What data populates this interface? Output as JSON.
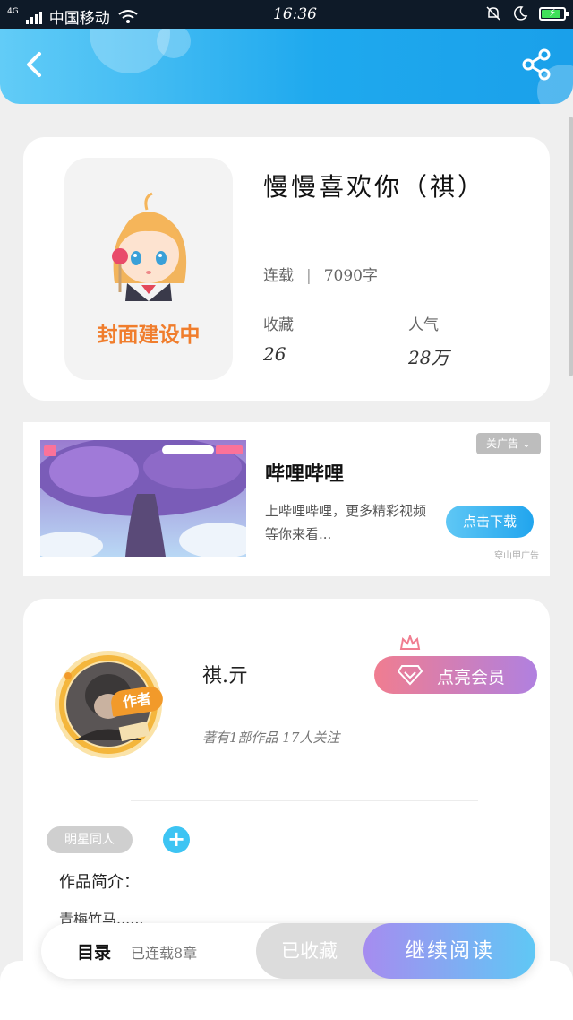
{
  "status_bar": {
    "network": "4G",
    "carrier": "中国移动",
    "time": "16:36"
  },
  "header": {
    "back_icon": "chevron-left-icon",
    "share_icon": "share-icon"
  },
  "book": {
    "cover_caption": "封面建设中",
    "title": "慢慢喜欢你（祺）",
    "status": "连载",
    "word_count": "7090字",
    "favorites_label": "收藏",
    "favorites_value": "26",
    "popularity_label": "人气",
    "popularity_value": "28万"
  },
  "ad": {
    "close_label": "关广告",
    "title": "哔哩哔哩",
    "description": "上哔哩哔哩，更多精彩视频等你来看...",
    "button_label": "点击下载",
    "source": "穿山甲广告"
  },
  "author": {
    "badge": "作者",
    "name": "祺.亓",
    "meta": "著有1部作品 17人关注",
    "vip_button": "点亮会员",
    "tag": "明星同人",
    "add_tag": "+",
    "intro_label": "作品简介：",
    "intro_text": "青梅竹马......"
  },
  "bottom_bar": {
    "toc_label": "目录",
    "chapter_status": "已连载8章",
    "collected_label": "已收藏",
    "continue_label": "继续阅读"
  },
  "colors": {
    "accent": "#1fa9ee",
    "cover_caption": "#f07d2c",
    "vip_gradient_start": "#f07d90",
    "vip_gradient_end": "#b080e0"
  }
}
